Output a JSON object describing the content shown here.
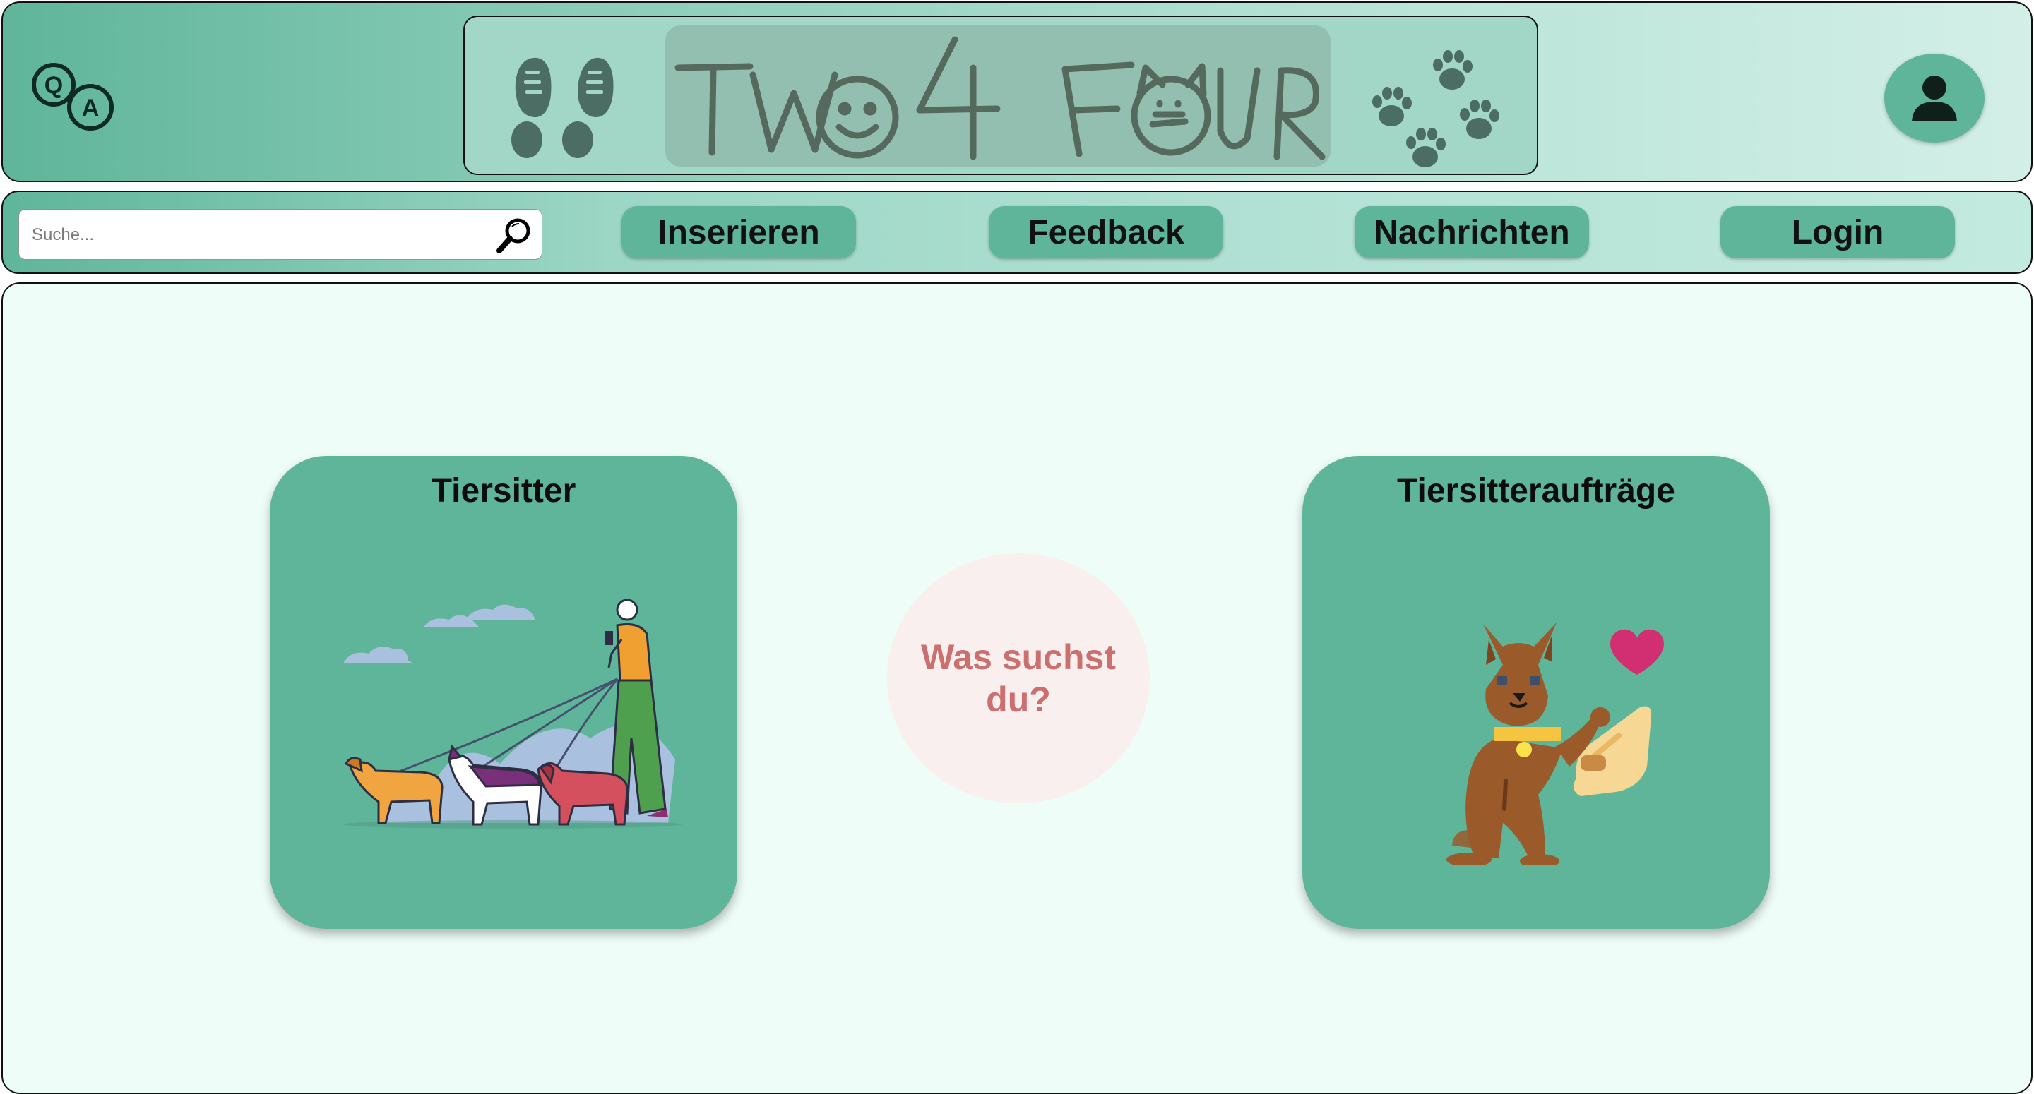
{
  "header": {
    "logo_text": "Q A",
    "brand_title": "TWO 4 FOUR",
    "profile_aria": "Profil"
  },
  "search": {
    "placeholder": "Suche..."
  },
  "nav": {
    "items": [
      {
        "label": "Inserieren"
      },
      {
        "label": "Feedback"
      },
      {
        "label": "Nachrichten"
      },
      {
        "label": "Login"
      }
    ]
  },
  "main": {
    "cards": [
      {
        "title": "Tiersitter",
        "illustration": "dog-walker-illustration"
      },
      {
        "title": "Tiersitteraufträge",
        "illustration": "dog-paw-hand-illustration"
      }
    ],
    "question": "Was suchst du?"
  },
  "colors": {
    "brand_green": "#5fb59a",
    "main_bg": "#effdf8",
    "question_text": "#cc6f6f",
    "question_bg": "#f9efef"
  }
}
